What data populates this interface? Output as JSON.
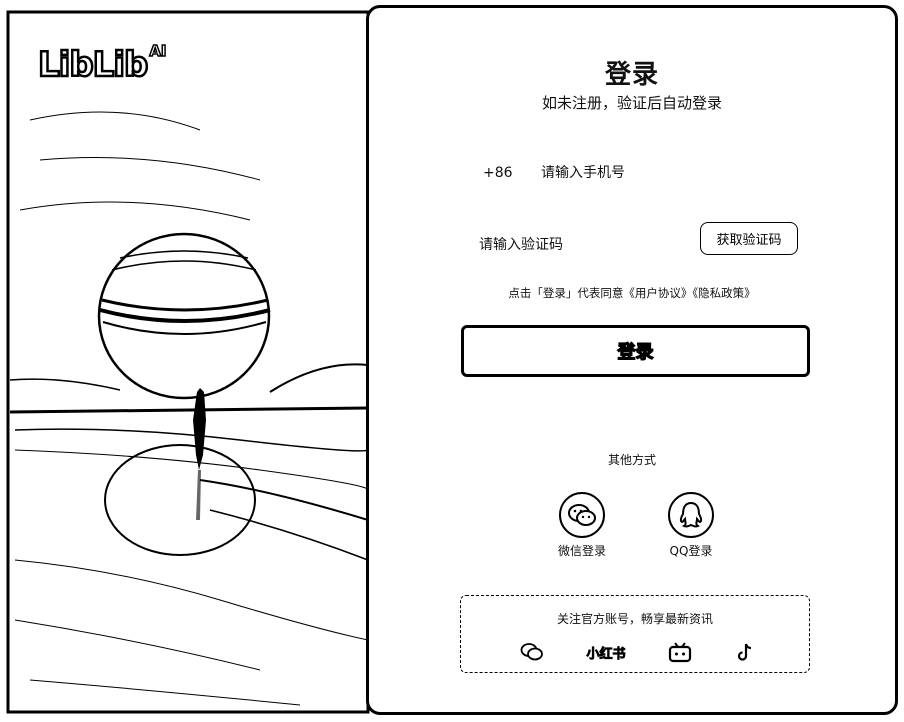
{
  "brand": {
    "name": "LibLib",
    "suffix": "AI"
  },
  "login": {
    "title": "登录",
    "subtitle": "如未注册，验证后自动登录",
    "country_code": "+86",
    "phone_placeholder": "请输入手机号",
    "code_placeholder": "请输入验证码",
    "get_code_label": "获取验证码",
    "agreement_prefix": "点击「登录」代表同意",
    "user_agreement": "《用户协议》",
    "privacy_policy": "《隐私政策》",
    "submit_label": "登录"
  },
  "other_methods": {
    "label": "其他方式",
    "wechat_label": "微信登录",
    "qq_label": "QQ登录"
  },
  "follow": {
    "text": "关注官方账号，畅享最新资讯",
    "xiaohongshu_label": "小红书",
    "icons": [
      "wechat-icon",
      "xiaohongshu-icon",
      "bilibili-icon",
      "tiktok-icon"
    ]
  },
  "colors": {
    "ink": "#000000",
    "background": "#ffffff"
  }
}
